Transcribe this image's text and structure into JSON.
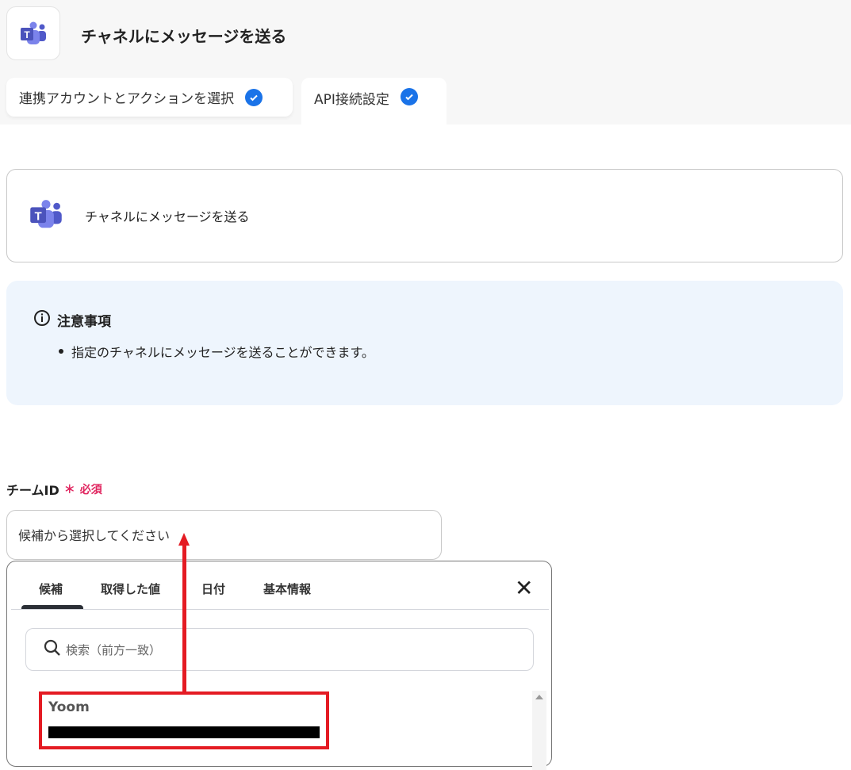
{
  "header": {
    "title": "チャネルにメッセージを送る",
    "icon": "teams-icon"
  },
  "tabs": [
    {
      "label": "連携アカウントとアクションを選択",
      "done": true
    },
    {
      "label": "API接続設定",
      "done": true
    }
  ],
  "action_card": {
    "label": "チャネルにメッセージを送る"
  },
  "notice": {
    "title": "注意事項",
    "items": [
      "指定のチャネルにメッセージを送ることができます。"
    ]
  },
  "field": {
    "label": "チームID",
    "required_mark": "＊",
    "required_label": "必須",
    "placeholder": "候補から選択してください"
  },
  "dropdown": {
    "tabs": [
      "候補",
      "取得した値",
      "日付",
      "基本情報"
    ],
    "active_tab": "候補",
    "search_placeholder": "検索（前方一致）",
    "options": [
      {
        "name": "Yoom"
      }
    ]
  },
  "colors": {
    "accent": "#1a73e8",
    "required": "#e0245e",
    "annotation": "#e41b23",
    "notice_bg": "#eef5fd"
  }
}
